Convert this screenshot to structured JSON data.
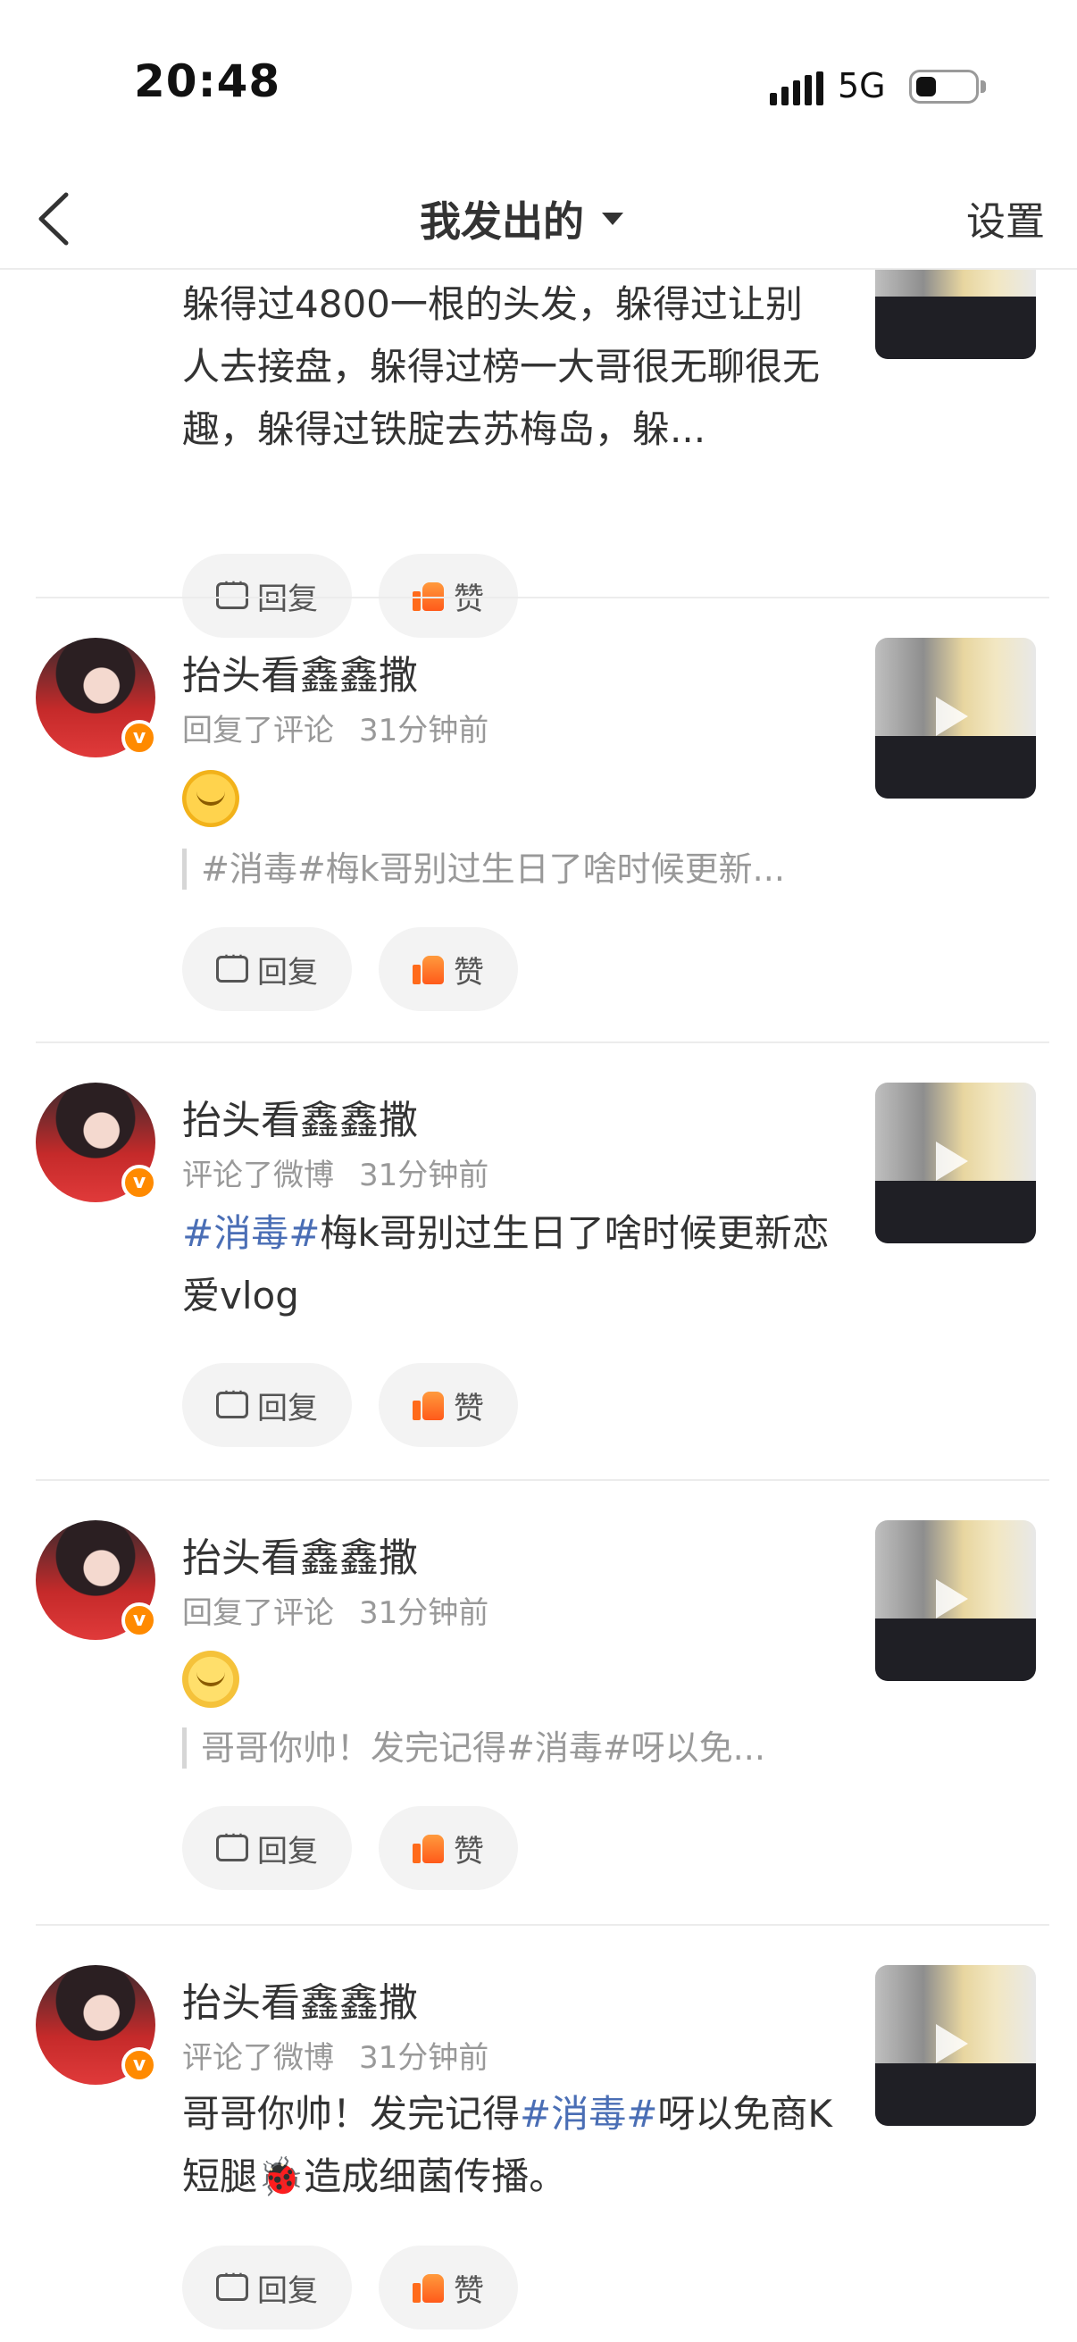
{
  "status_bar": {
    "time": "20:48",
    "network": "5G"
  },
  "nav": {
    "title": "我发出的",
    "settings": "设置"
  },
  "buttons": {
    "reply": "回复",
    "like": "赞"
  },
  "first_item_partial": {
    "text": "躲得过4800一根的头发，躲得过让别人去接盘，躲得过榜一大哥很无聊很无趣，躲得过铁腚去苏梅岛，躲..."
  },
  "items": [
    {
      "name": "抬头看鑫鑫撒",
      "action": "回复了评论",
      "time": "31分钟前",
      "quote": "#消毒#梅k哥别过生日了啥时候更新..."
    },
    {
      "name": "抬头看鑫鑫撒",
      "action": "评论了微博",
      "time": "31分钟前",
      "content_topic": "#消毒#",
      "content_rest": "梅k哥别过生日了啥时候更新恋爱vlog"
    },
    {
      "name": "抬头看鑫鑫撒",
      "action": "回复了评论",
      "time": "31分钟前",
      "quote": "哥哥你帅！发完记得#消毒#呀以免..."
    },
    {
      "name": "抬头看鑫鑫撒",
      "action": "评论了微博",
      "time": "31分钟前",
      "content_pre": "哥哥你帅！发完记得",
      "content_topic": "#消毒#",
      "content_post": "呀以免商K短腿🐞造成细菌传播。"
    }
  ]
}
